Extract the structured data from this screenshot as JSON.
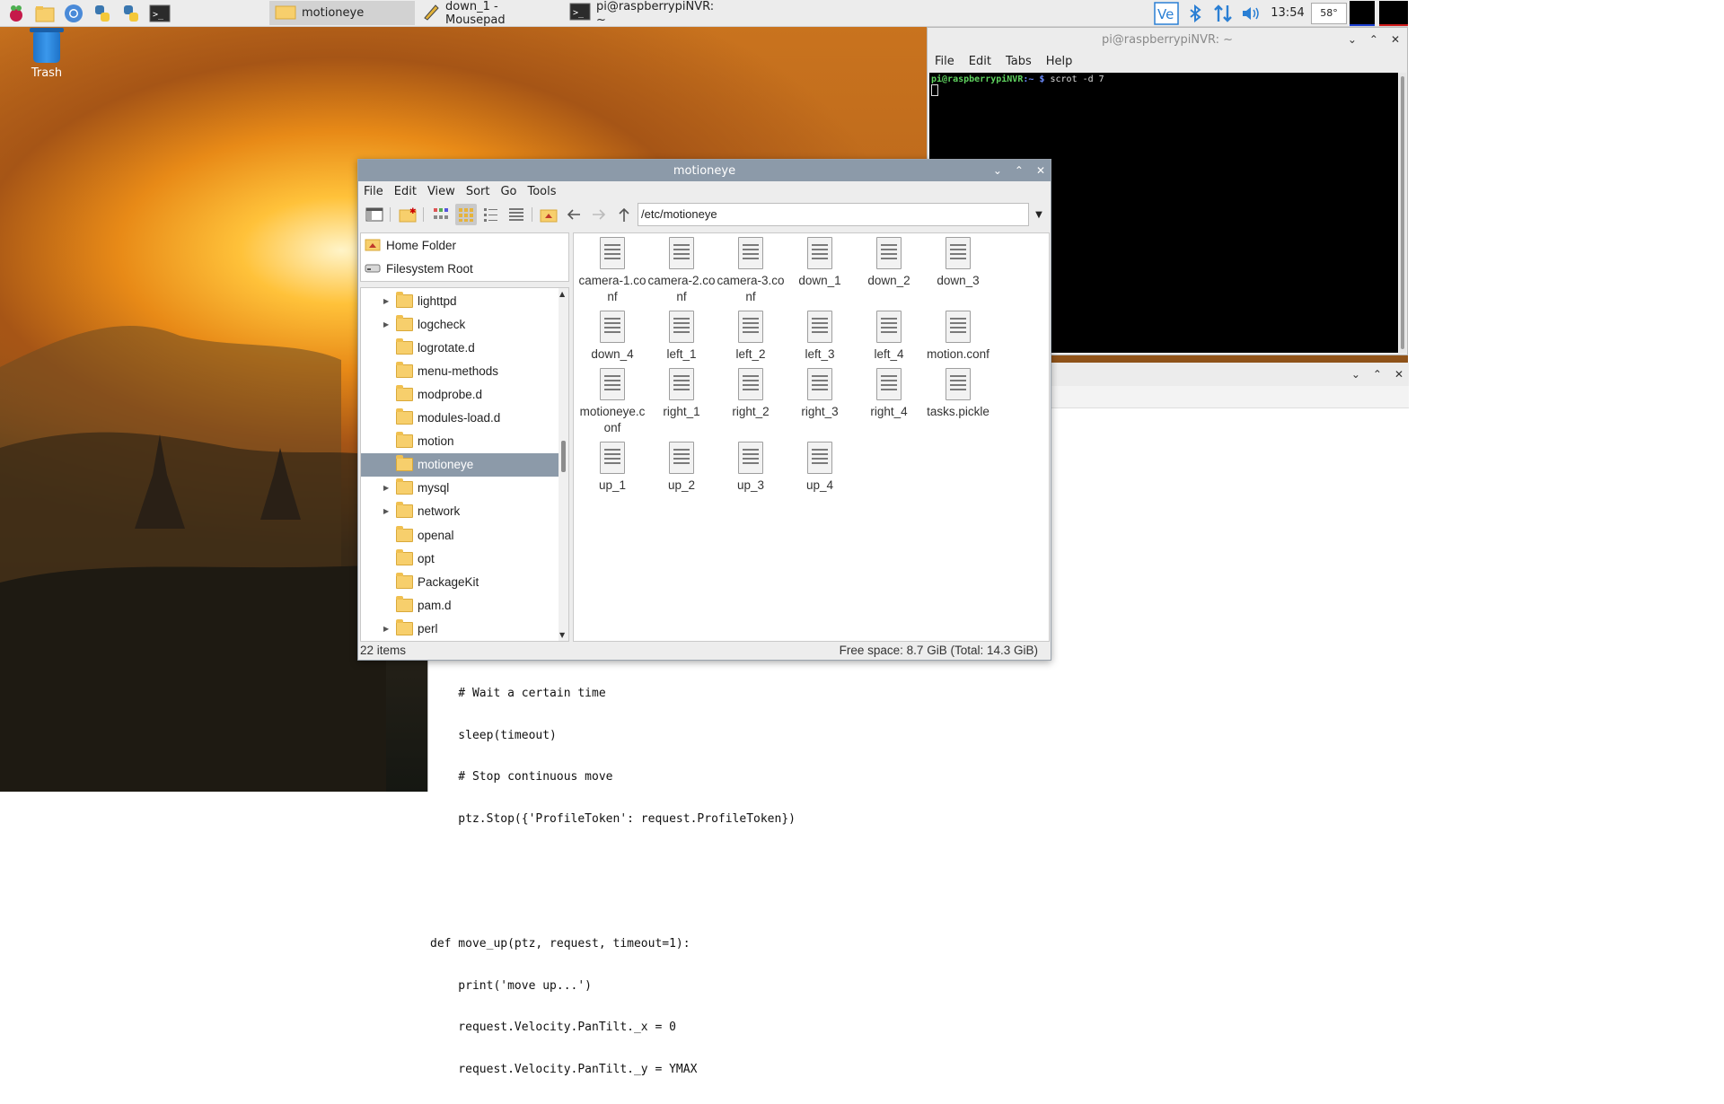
{
  "taskbar": {
    "launchers": [
      "raspberry-menu-icon",
      "file-manager-icon",
      "chromium-icon",
      "python-icon",
      "python-icon",
      "terminal-icon"
    ],
    "tasks": [
      {
        "label": "motioneye",
        "icon": "folder-icon",
        "active": true
      },
      {
        "label": "down_1 - Mousepad",
        "icon": "pencil-icon",
        "active": false
      },
      {
        "label": "pi@raspberrypiNVR: ~",
        "icon": "terminal-icon",
        "active": false
      }
    ],
    "clock": "13:54",
    "cpu_temp": "58°"
  },
  "desktop": {
    "trash_label": "Trash"
  },
  "terminal": {
    "title": "pi@raspberrypiNVR: ~",
    "menu": [
      "File",
      "Edit",
      "Tabs",
      "Help"
    ],
    "prompt_user": "pi@raspberrypiNVR",
    "prompt_path": ":~ $",
    "command": "scrot -d 7"
  },
  "mousepad": {
    "code_lines": [
      "    # Wait a certain time",
      "    sleep(timeout)",
      "    # Stop continuous move",
      "    ptz.Stop({'ProfileToken': request.ProfileToken})",
      "",
      "",
      "def move_up(ptz, request, timeout=1):",
      "    print('move up...')",
      "    request.Velocity.PanTilt._x = 0",
      "    request.Velocity.PanTilt._y = YMAX"
    ]
  },
  "file_manager": {
    "title": "motioneye",
    "menu": [
      "File",
      "Edit",
      "View",
      "Sort",
      "Go",
      "Tools"
    ],
    "path": "/etc/motioneye",
    "places": [
      "Home Folder",
      "Filesystem Root"
    ],
    "tree": [
      {
        "name": "lighttpd",
        "expandable": true,
        "selected": false
      },
      {
        "name": "logcheck",
        "expandable": true,
        "selected": false
      },
      {
        "name": "logrotate.d",
        "expandable": false,
        "selected": false
      },
      {
        "name": "menu-methods",
        "expandable": false,
        "selected": false
      },
      {
        "name": "modprobe.d",
        "expandable": false,
        "selected": false
      },
      {
        "name": "modules-load.d",
        "expandable": false,
        "selected": false
      },
      {
        "name": "motion",
        "expandable": false,
        "selected": false
      },
      {
        "name": "motioneye",
        "expandable": false,
        "selected": true
      },
      {
        "name": "mysql",
        "expandable": true,
        "selected": false
      },
      {
        "name": "network",
        "expandable": true,
        "selected": false
      },
      {
        "name": "openal",
        "expandable": false,
        "selected": false
      },
      {
        "name": "opt",
        "expandable": false,
        "selected": false
      },
      {
        "name": "PackageKit",
        "expandable": false,
        "selected": false
      },
      {
        "name": "pam.d",
        "expandable": false,
        "selected": false
      },
      {
        "name": "perl",
        "expandable": true,
        "selected": false
      }
    ],
    "files": [
      {
        "line1": "camera-1.co",
        "line2": "nf"
      },
      {
        "line1": "camera-2.co",
        "line2": "nf"
      },
      {
        "line1": "camera-3.co",
        "line2": "nf"
      },
      {
        "line1": "down_1",
        "line2": ""
      },
      {
        "line1": "down_2",
        "line2": ""
      },
      {
        "line1": "down_3",
        "line2": ""
      },
      {
        "line1": "down_4",
        "line2": ""
      },
      {
        "line1": "left_1",
        "line2": ""
      },
      {
        "line1": "left_2",
        "line2": ""
      },
      {
        "line1": "left_3",
        "line2": ""
      },
      {
        "line1": "left_4",
        "line2": ""
      },
      {
        "line1": "motion.conf",
        "line2": ""
      },
      {
        "line1": "motioneye.c",
        "line2": "onf"
      },
      {
        "line1": "right_1",
        "line2": ""
      },
      {
        "line1": "right_2",
        "line2": ""
      },
      {
        "line1": "right_3",
        "line2": ""
      },
      {
        "line1": "right_4",
        "line2": ""
      },
      {
        "line1": "tasks.pickle",
        "line2": ""
      },
      {
        "line1": "up_1",
        "line2": ""
      },
      {
        "line1": "up_2",
        "line2": ""
      },
      {
        "line1": "up_3",
        "line2": ""
      },
      {
        "line1": "up_4",
        "line2": ""
      }
    ],
    "status_left": "22 items",
    "status_right": "Free space: 8.7 GiB (Total: 14.3 GiB)"
  },
  "colors": {
    "selection": "#8c9aa9",
    "folder": "#f7cf6c",
    "terminal_bg": "#000000"
  }
}
